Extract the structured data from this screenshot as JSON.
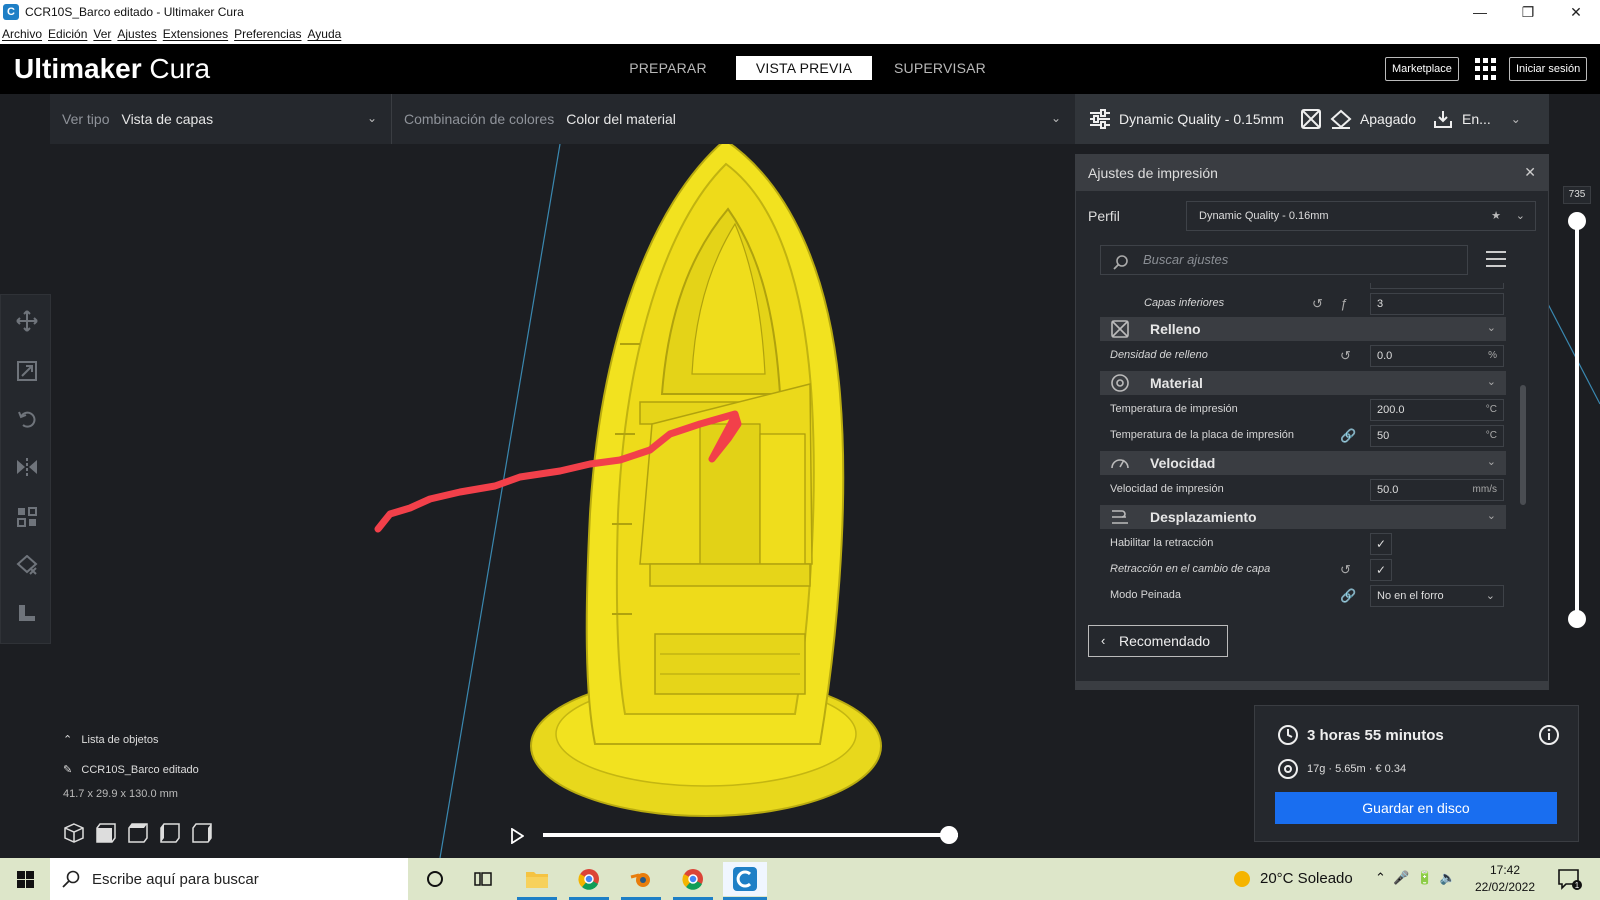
{
  "window": {
    "title": "CCR10S_Barco editado - Ultimaker Cura",
    "app_icon_letter": "C",
    "minimize": "—",
    "maximize": "❐",
    "close": "✕"
  },
  "menu": [
    "Archivo",
    "Edición",
    "Ver",
    "Ajustes",
    "Extensiones",
    "Preferencias",
    "Ayuda"
  ],
  "header": {
    "brand_bold": "Ultimaker",
    "brand_light": "Cura",
    "tabs": [
      {
        "label": "PREPARAR",
        "active": false
      },
      {
        "label": "VISTA PREVIA",
        "active": true
      },
      {
        "label": "SUPERVISAR",
        "active": false
      }
    ],
    "marketplace": "Marketplace",
    "login": "Iniciar sesión"
  },
  "viewbar": {
    "view_type_label": "Ver tipo",
    "view_type_value": "Vista de capas",
    "color_scheme_label": "Combinación de colores",
    "color_scheme_value": "Color del material"
  },
  "printbar": {
    "profile": "Dynamic Quality - 0.15mm",
    "support": "Apagado",
    "adhesion": "En..."
  },
  "settings": {
    "title": "Ajustes de impresión",
    "profile_label": "Perfil",
    "profile_value": "Dynamic Quality - 0.16mm",
    "search_placeholder": "Buscar ajustes",
    "rows": {
      "bottom_layers": {
        "label": "Capas inferiores",
        "value": "3"
      },
      "infill_cat": "Relleno",
      "infill_density": {
        "label": "Densidad de relleno",
        "value": "0.0",
        "unit": "%"
      },
      "material_cat": "Material",
      "print_temp": {
        "label": "Temperatura de impresión",
        "value": "200.0",
        "unit": "°C"
      },
      "bed_temp": {
        "label": "Temperatura de la placa de impresión",
        "value": "50",
        "unit": "°C"
      },
      "speed_cat": "Velocidad",
      "print_speed": {
        "label": "Velocidad de impresión",
        "value": "50.0",
        "unit": "mm/s"
      },
      "travel_cat": "Desplazamiento",
      "enable_retraction": {
        "label": "Habilitar la retracción",
        "checked": true
      },
      "retract_layer_change": {
        "label": "Retracción en el cambio de capa",
        "checked": true
      },
      "combing": {
        "label": "Modo Peinada",
        "value": "No en el forro"
      }
    },
    "recommended_button": "Recomendado"
  },
  "layer_slider": {
    "max_layer": "735"
  },
  "object_list": {
    "header": "Lista de objetos",
    "file": "CCR10S_Barco editado",
    "dimensions": "41.7 x 29.9 x 130.0 mm"
  },
  "job": {
    "time": "3 horas 55 minutos",
    "material": "17g · 5.65m · € 0.34",
    "save_button": "Guardar en disco"
  },
  "taskbar": {
    "search_placeholder": "Escribe aquí para buscar",
    "weather": "20°C  Soleado",
    "time": "17:42",
    "date": "22/02/2022",
    "notification_count": "1"
  },
  "colors": {
    "model_yellow": "#f2e21f",
    "annotation_red": "#f2404a",
    "accent_blue": "#196ef0",
    "header_bg": "#000000",
    "panel_bg": "#25282d"
  }
}
